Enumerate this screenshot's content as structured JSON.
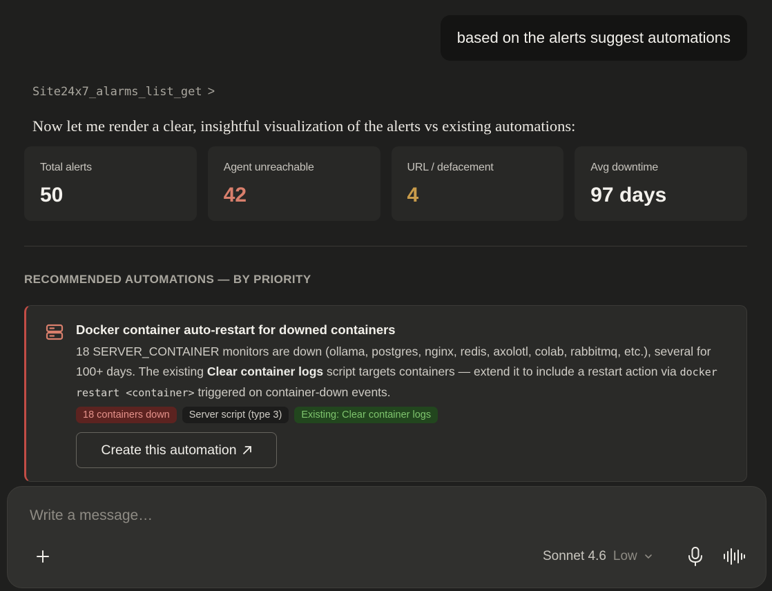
{
  "user_message": "based on the alerts suggest automations",
  "tool_call": {
    "name": "Site24x7_alarms_list_get",
    "chevron": ">"
  },
  "assistant_text": "Now let me render a clear, insightful visualization of the alerts vs existing automations:",
  "stats": [
    {
      "label": "Total alerts",
      "value": "50",
      "color": "#f3f1ec"
    },
    {
      "label": "Agent unreachable",
      "value": "42",
      "color": "#d97f6c"
    },
    {
      "label": "URL / defacement",
      "value": "4",
      "color": "#c89b4a"
    },
    {
      "label": "Avg downtime",
      "value": "97 days",
      "color": "#f3f1ec"
    }
  ],
  "section_title": "RECOMMENDED AUTOMATIONS — BY PRIORITY",
  "recommendation": {
    "icon": "server-icon",
    "title": "Docker container auto-restart for downed containers",
    "desc_part1": "18 SERVER_CONTAINER monitors are down (ollama, postgres, nginx, redis, axolotl, colab, rabbitmq, etc.), several for 100+ days. The existing ",
    "desc_bold": "Clear container logs",
    "desc_part2": " script targets containers — extend it to include a restart action via ",
    "desc_code": "docker restart <container>",
    "desc_part3": " triggered on container-down events.",
    "tags": [
      {
        "text": "18 containers down",
        "tone": "red"
      },
      {
        "text": "Server script (type 3)",
        "tone": "gray"
      },
      {
        "text": "Existing: Clear container logs",
        "tone": "green"
      }
    ],
    "button_label": "Create this automation",
    "button_icon": "external-arrow-icon",
    "priority_color": "#c24d46"
  },
  "composer": {
    "placeholder": "Write a message…",
    "model": "Sonnet 4.6",
    "effort": "Low"
  }
}
